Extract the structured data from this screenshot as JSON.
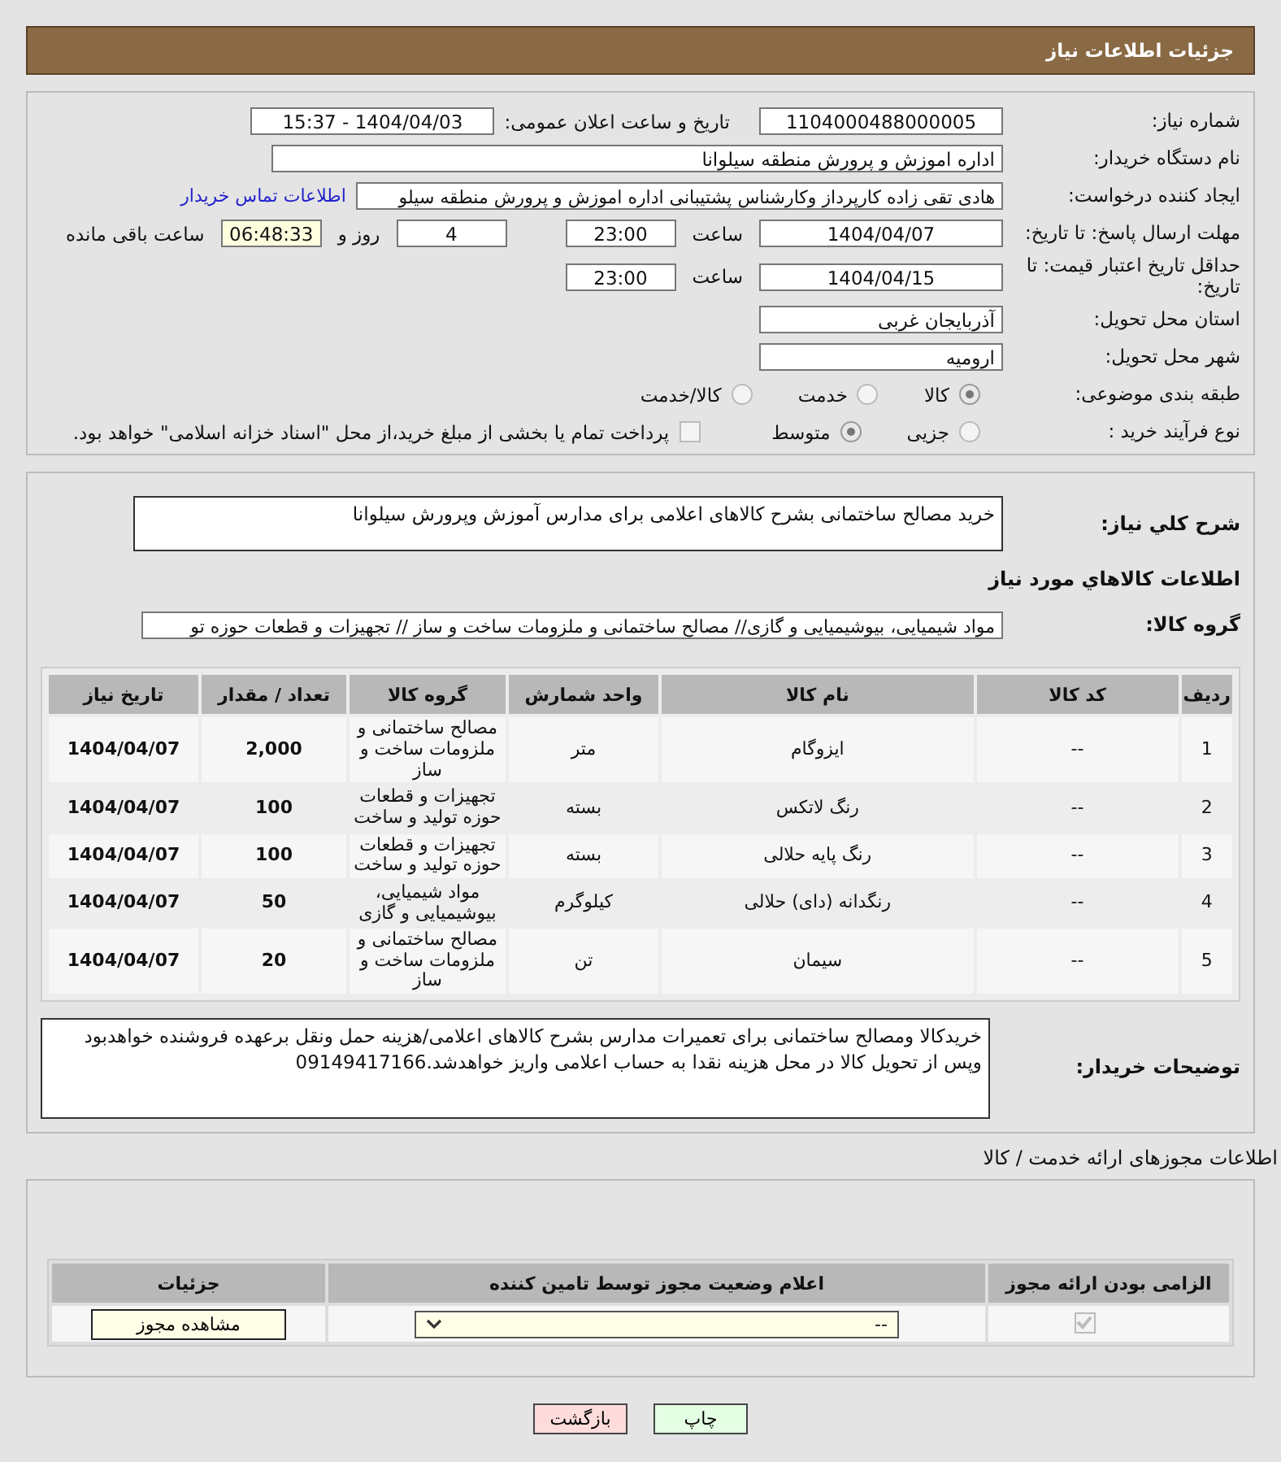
{
  "header": {
    "title": "جزئیات اطلاعات نیاز"
  },
  "need_number": {
    "label": "شماره نیاز:",
    "value": "1104000488000005"
  },
  "announce": {
    "label": "تاریخ و ساعت اعلان عمومی:",
    "value": "1404/04/03 - 15:37"
  },
  "buyer": {
    "label": "نام دستگاه خریدار:",
    "value": "اداره اموزش و پرورش منطقه سیلوانا"
  },
  "requester": {
    "label": "ایجاد کننده درخواست:",
    "value": "هادی تقی زاده کارپرداز وکارشناس پشتیبانی اداره اموزش و پرورش منطقه سیلو",
    "link": "اطلاعات تماس خریدار"
  },
  "reply_deadline": {
    "label": "مهلت ارسال پاسخ: تا تاریخ:",
    "date": "1404/04/07",
    "time_label": "ساعت",
    "time": "23:00",
    "days": "4",
    "days_label": "روز و",
    "remaining": "06:48:33",
    "remaining_label": "ساعت باقی مانده"
  },
  "price_validity": {
    "label": "حداقل تاریخ اعتبار قیمت: تا تاریخ:",
    "date": "1404/04/15",
    "time_label": "ساعت",
    "time": "23:00"
  },
  "province": {
    "label": "استان محل تحویل:",
    "value": "آذربایجان غربی"
  },
  "city": {
    "label": "شهر محل تحویل:",
    "value": "ارومیه"
  },
  "category": {
    "label": "طبقه بندی موضوعی:",
    "options": [
      {
        "label": "کالا",
        "selected": true
      },
      {
        "label": "خدمت",
        "selected": false
      },
      {
        "label": "کالا/خدمت",
        "selected": false
      }
    ]
  },
  "process": {
    "label": "نوع فرآیند خرید :",
    "options": [
      {
        "label": "جزیی",
        "selected": false
      },
      {
        "label": "متوسط",
        "selected": true
      }
    ],
    "payment": {
      "label": "پرداخت تمام یا بخشی از مبلغ خرید،از محل \"اسناد خزانه اسلامی\" خواهد بود.",
      "checked": false
    }
  },
  "summary": {
    "label": "شرح کلي نیاز:",
    "value": "خرید مصالح ساختمانی بشرح کالاهای اعلامی برای مدارس آموزش وپرورش سیلوانا"
  },
  "goods_title": "اطلاعات کالاهاي مورد نیاز",
  "goods_group": {
    "label": "گروه کالا:",
    "value": "مواد شیمیایی، بیوشیمیایی و  گازی// مصالح ساختمانی و ملزومات ساخت و ساز // تجهیزات و قطعات حوزه تو"
  },
  "table": {
    "columns": [
      "ردیف",
      "کد کالا",
      "نام کالا",
      "واحد شمارش",
      "گروه کالا",
      "تعداد / مقدار",
      "تاریخ نیاز"
    ],
    "rows": [
      [
        "1",
        "--",
        "ایزوگام",
        "متر",
        "مصالح ساختمانی و ملزومات ساخت و ساز",
        "2,000",
        "1404/04/07"
      ],
      [
        "2",
        "--",
        "رنگ لاتکس",
        "بسته",
        "تجهیزات و قطعات حوزه تولید و ساخت",
        "100",
        "1404/04/07"
      ],
      [
        "3",
        "--",
        "رنگ پایه حلالی",
        "بسته",
        "تجهیزات و قطعات حوزه تولید و ساخت",
        "100",
        "1404/04/07"
      ],
      [
        "4",
        "--",
        "رنگدانه (دای) حلالی",
        "کیلوگرم",
        "مواد شیمیایی، بیوشیمیایی و گازی",
        "50",
        "1404/04/07"
      ],
      [
        "5",
        "--",
        "سیمان",
        "تن",
        "مصالح ساختمانی و ملزومات ساخت و ساز",
        "20",
        "1404/04/07"
      ]
    ]
  },
  "notes": {
    "label": "توضیحات خریدار:",
    "value": "خریدکالا ومصالح ساختمانی برای تعمیرات مدارس بشرح کالاهای اعلامی/هزینه حمل ونقل برعهده فروشنده خواهدبود وپس از تحویل کالا در محل هزینه نقدا به حساب اعلامی واریز خواهدشد.09149417166"
  },
  "permits": {
    "title": "اطلاعات مجوزهای ارائه خدمت / کالا",
    "columns": [
      "الزامی بودن ارائه مجوز",
      "اعلام وضعیت مجوز توسط تامین کننده",
      "جزئیات"
    ],
    "rows": [
      {
        "required": true,
        "status": "--",
        "details": "مشاهده مجوز"
      }
    ]
  },
  "buttons": [
    {
      "label": "چاپ",
      "kind": "print"
    },
    {
      "label": "بازگشت",
      "kind": "back"
    }
  ]
}
